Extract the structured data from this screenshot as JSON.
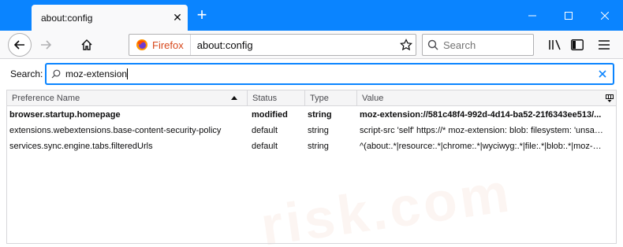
{
  "tab": {
    "title": "about:config"
  },
  "window": {
    "accent_color": "#0a84ff"
  },
  "toolbar": {
    "identity_label": "Firefox",
    "url": "about:config",
    "search_placeholder": "Search"
  },
  "config_search": {
    "label": "Search:",
    "value": "moz-extension"
  },
  "table": {
    "columns": [
      "Preference Name",
      "Status",
      "Type",
      "Value"
    ],
    "rows": [
      {
        "name": "browser.startup.homepage",
        "status": "modified",
        "type": "string",
        "value": "moz-extension://581c48f4-992d-4d14-ba52-21f6343ee513/...",
        "bold": true
      },
      {
        "name": "extensions.webextensions.base-content-security-policy",
        "status": "default",
        "type": "string",
        "value": "script-src 'self' https://* moz-extension: blob: filesystem: 'unsafe-...",
        "bold": false
      },
      {
        "name": "services.sync.engine.tabs.filteredUrls",
        "status": "default",
        "type": "string",
        "value": "^(about:.*|resource:.*|chrome:.*|wyciwyg:.*|file:.*|blob:.*|moz-exte...",
        "bold": false
      }
    ]
  },
  "watermark": "risk.com"
}
